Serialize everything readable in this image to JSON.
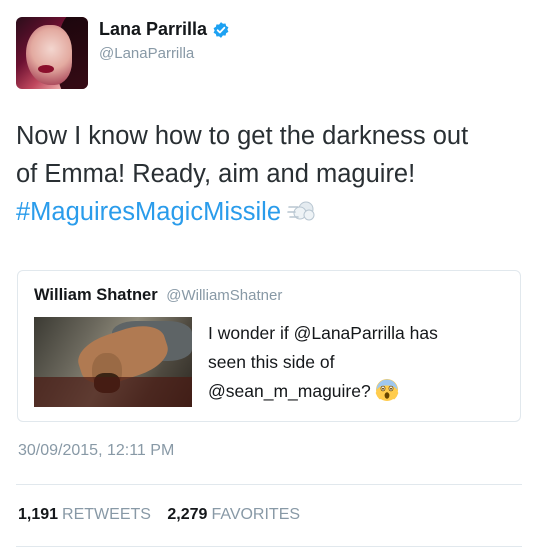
{
  "author": {
    "display_name": "Lana Parrilla",
    "handle": "@LanaParrilla"
  },
  "tweet": {
    "text_line1": "Now I know how to get the darkness out",
    "text_line2": "of Emma! Ready, aim and maguire!",
    "hashtag": "#MaguiresMagicMissile",
    "hashtag_emoji": "dash-symbol-emoji"
  },
  "quoted_tweet": {
    "display_name": "William Shatner",
    "handle": "@WilliamShatner",
    "text_line1": "I wonder if @LanaParrilla has",
    "text_line2": "seen this side of",
    "text_line3": "@sean_m_maguire?",
    "emoji": "face-screaming-in-fear-emoji"
  },
  "meta": {
    "timestamp": "30/09/2015, 12:11 PM"
  },
  "stats": {
    "retweets_count": "1,191",
    "retweets_label": "RETWEETS",
    "favorites_count": "2,279",
    "favorites_label": "FAVORITES"
  },
  "colors": {
    "link": "#2a9ceb",
    "verified": "#1da1f2",
    "muted": "#8899a6",
    "border": "#e1e8ed"
  }
}
